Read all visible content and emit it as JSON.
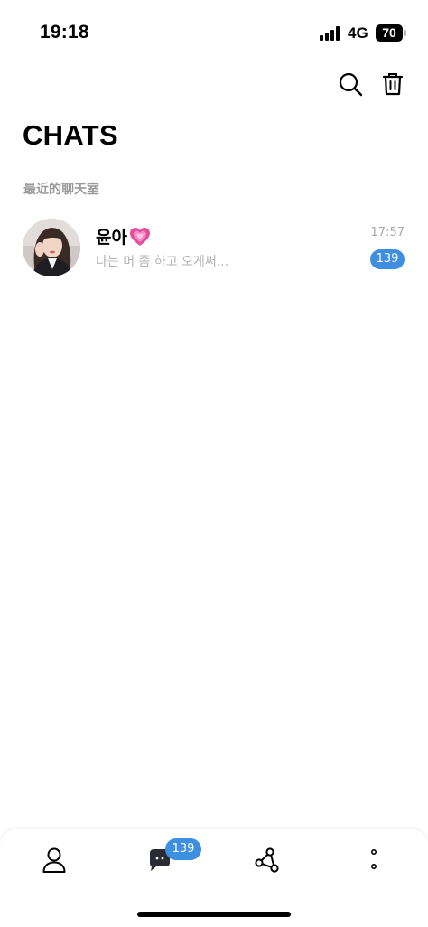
{
  "status_bar": {
    "time": "19:18",
    "network": "4G",
    "battery": "70"
  },
  "toolbar": {
    "search_icon": "search-icon",
    "delete_icon": "trash-icon"
  },
  "page": {
    "title": "CHATS",
    "section_title": "最近的聊天室"
  },
  "chats": [
    {
      "name": "윤아",
      "name_emoji": "growing-heart-icon",
      "preview": "나는 머 좀 하고 오게써...",
      "time": "17:57",
      "unread": "139"
    }
  ],
  "bottom_nav": {
    "items": [
      "profile-icon",
      "chat-bubble-icon",
      "share-network-icon",
      "more-vertical-icon"
    ],
    "chat_badge": "139"
  },
  "colors": {
    "accent": "#3e8fe0",
    "secondary_text": "#9a9a9a"
  }
}
